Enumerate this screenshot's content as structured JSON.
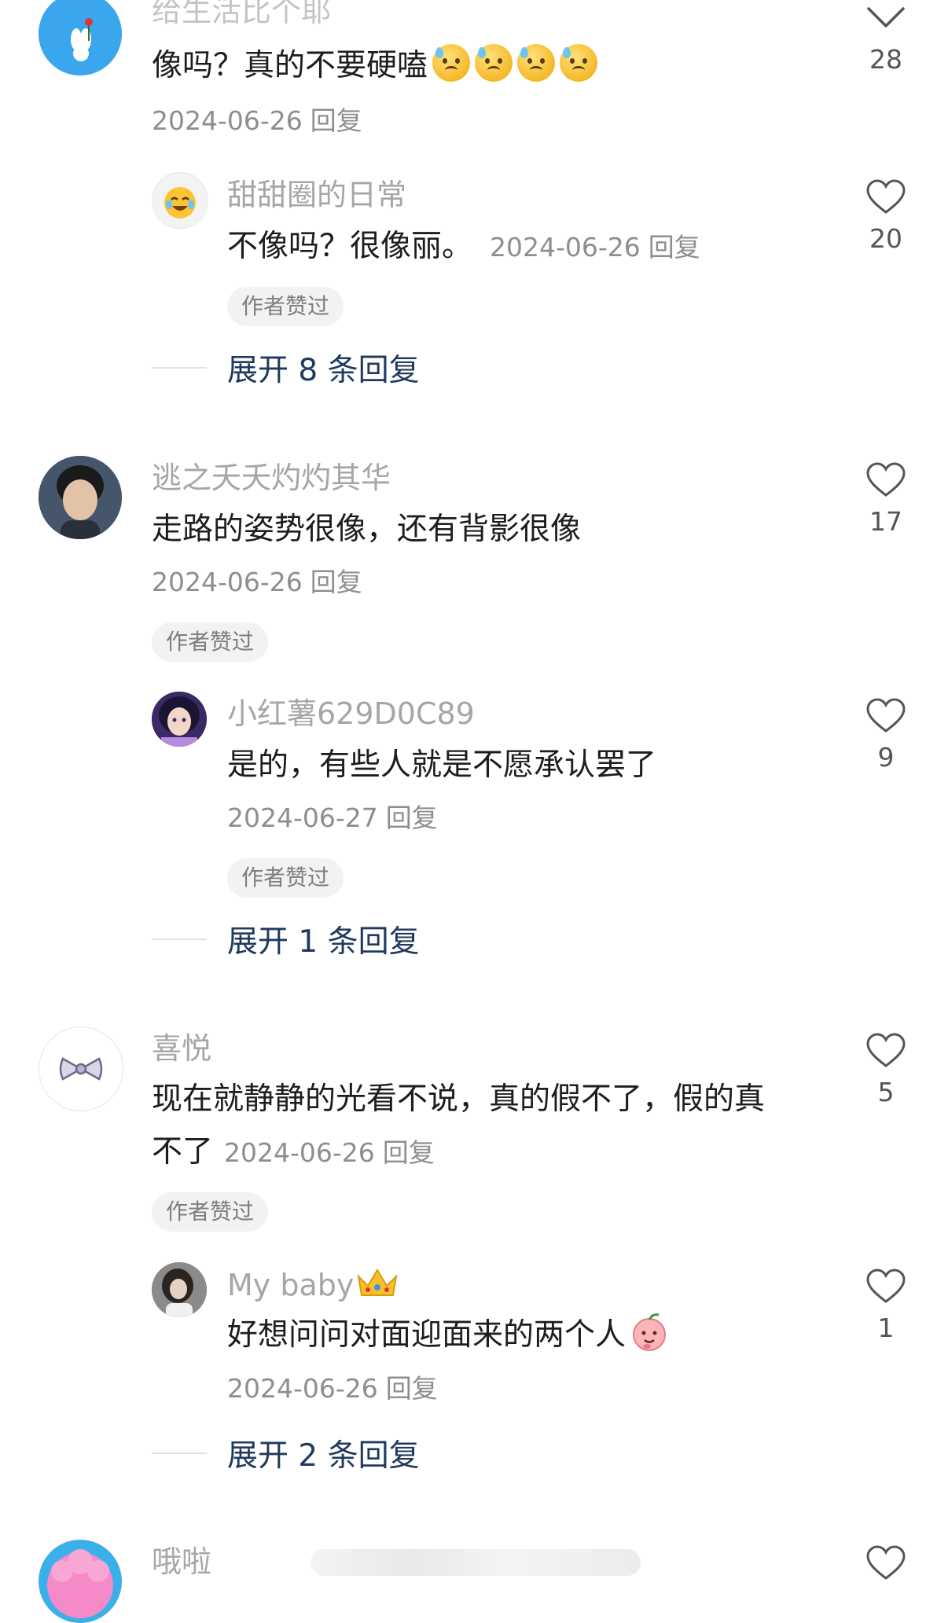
{
  "comments": [
    {
      "username": "给生活比个耶",
      "text": "像吗？真的不要硬嗑",
      "emoji_count": 4,
      "date": "2024-06-26",
      "reply_label": "回复",
      "likes": "28",
      "replies": [
        {
          "username": "甜甜圈的日常",
          "text": "不像吗？很像丽。",
          "date": "2024-06-26",
          "reply_label": "回复",
          "likes": "20",
          "badge": "作者赞过"
        }
      ],
      "expand_label": "展开 8 条回复"
    },
    {
      "username": "逃之夭夭灼灼其华",
      "text": "走路的姿势很像，还有背影很像",
      "date": "2024-06-26",
      "reply_label": "回复",
      "likes": "17",
      "badge": "作者赞过",
      "replies": [
        {
          "username": "小红薯629D0C89",
          "text": "是的，有些人就是不愿承认罢了",
          "date": "2024-06-27",
          "reply_label": "回复",
          "likes": "9",
          "badge": "作者赞过"
        }
      ],
      "expand_label": "展开 1 条回复"
    },
    {
      "username": "喜悦",
      "text_line1": "现在就静静的光看不说，真的假不了，假的真",
      "text_line2": "不了",
      "date": "2024-06-26",
      "reply_label": "回复",
      "likes": "5",
      "badge": "作者赞过",
      "replies": [
        {
          "username": "My baby",
          "text": "好想问问对面迎面来的两个人",
          "date": "2024-06-26",
          "reply_label": "回复",
          "likes": "1"
        }
      ],
      "expand_label": "展开 2 条回复"
    },
    {
      "username": "哦啦"
    }
  ]
}
